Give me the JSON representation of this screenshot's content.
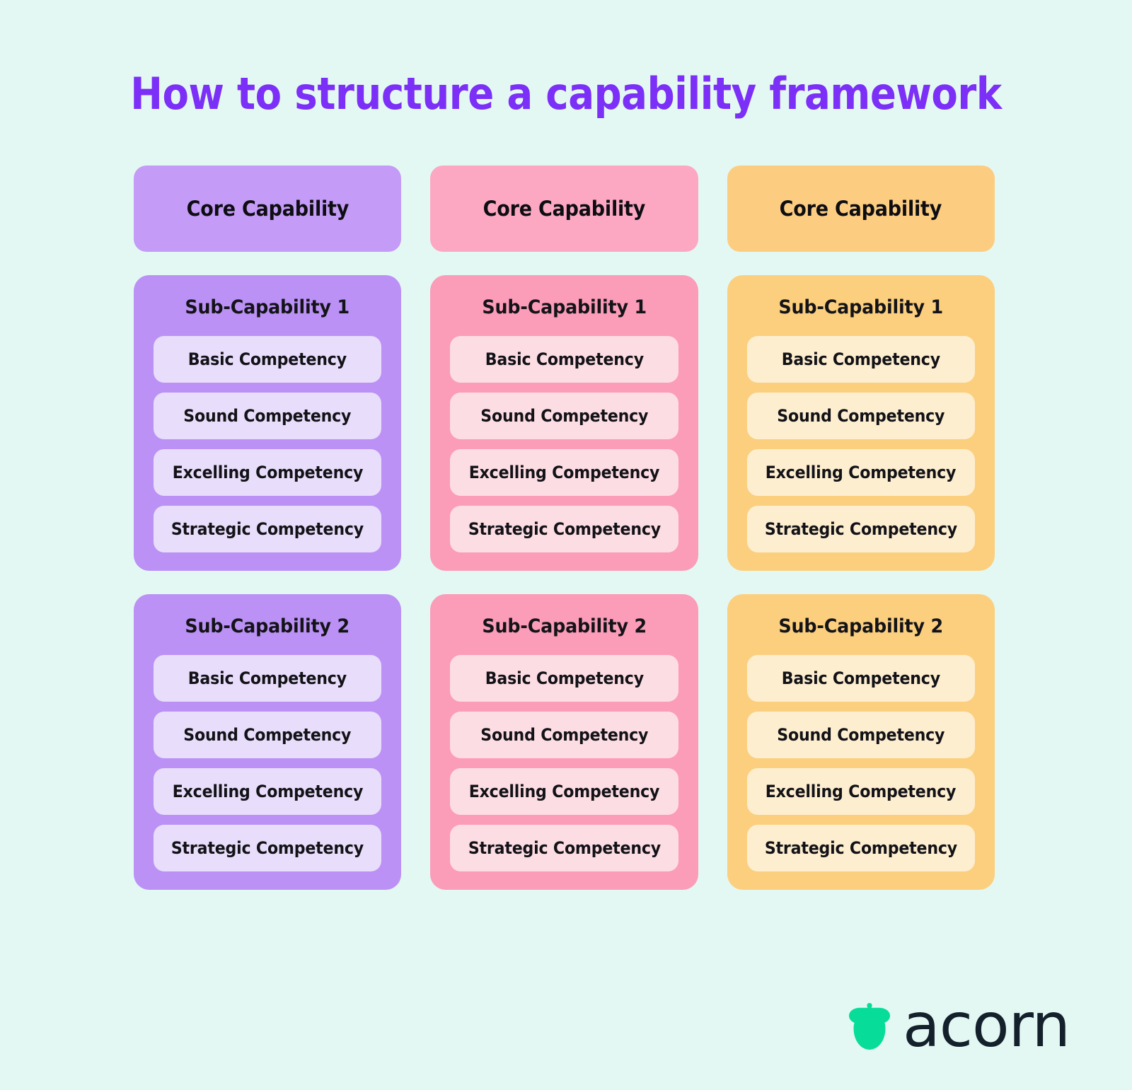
{
  "page": {
    "title": "How to structure a capability framework",
    "background_color": "#e4f8f3",
    "title_color": "#7b2ff7"
  },
  "columns": [
    {
      "theme": "purple",
      "colors": {
        "header": "#c49bf7",
        "card": "#bb91f5",
        "pill": "#e8ddfa"
      },
      "core_label": "Core Capability",
      "sub_capabilities": [
        {
          "title": "Sub-Capability 1",
          "competencies": [
            "Basic Competency",
            "Sound Competency",
            "Excelling Competency",
            "Strategic Competency"
          ]
        },
        {
          "title": "Sub-Capability 2",
          "competencies": [
            "Basic Competency",
            "Sound Competency",
            "Excelling Competency",
            "Strategic Competency"
          ]
        }
      ]
    },
    {
      "theme": "pink",
      "colors": {
        "header": "#fca8c2",
        "card": "#fb9cb8",
        "pill": "#fddde4"
      },
      "core_label": "Core Capability",
      "sub_capabilities": [
        {
          "title": "Sub-Capability 1",
          "competencies": [
            "Basic Competency",
            "Sound Competency",
            "Excelling Competency",
            "Strategic Competency"
          ]
        },
        {
          "title": "Sub-Capability 2",
          "competencies": [
            "Basic Competency",
            "Sound Competency",
            "Excelling Competency",
            "Strategic Competency"
          ]
        }
      ]
    },
    {
      "theme": "yellow",
      "colors": {
        "header": "#fccd80",
        "card": "#fbcf7e",
        "pill": "#fdeed0"
      },
      "core_label": "Core Capability",
      "sub_capabilities": [
        {
          "title": "Sub-Capability 1",
          "competencies": [
            "Basic Competency",
            "Sound Competency",
            "Excelling Competency",
            "Strategic Competency"
          ]
        },
        {
          "title": "Sub-Capability 2",
          "competencies": [
            "Basic Competency",
            "Sound Competency",
            "Excelling Competency",
            "Strategic Competency"
          ]
        }
      ]
    }
  ],
  "logo": {
    "icon": "acorn-icon",
    "wordmark": "acorn",
    "icon_color": "#07dd98",
    "word_color": "#14202b"
  }
}
